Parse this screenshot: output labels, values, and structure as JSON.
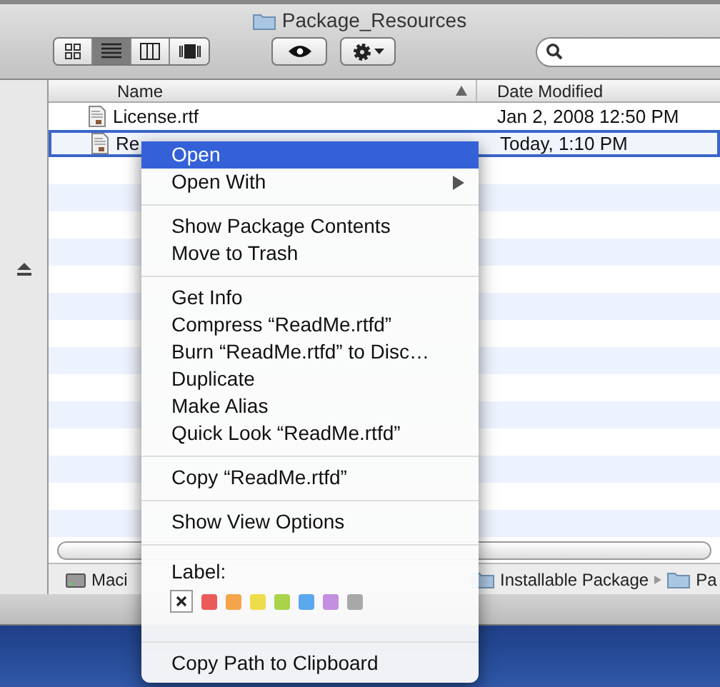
{
  "window": {
    "title": "Package_Resources"
  },
  "toolbar": {
    "view_buttons": [
      {
        "kind": "icons",
        "selected": false
      },
      {
        "kind": "list",
        "selected": true
      },
      {
        "kind": "columns",
        "selected": false
      },
      {
        "kind": "coverflow",
        "selected": false
      }
    ]
  },
  "table": {
    "columns": [
      {
        "label": "Name",
        "sorted": true
      },
      {
        "label": "Date Modified",
        "sorted": false
      }
    ],
    "rows": [
      {
        "name": "License.rtf",
        "date": "Jan 2, 2008 12:50 PM",
        "selected": false
      },
      {
        "name": "Re",
        "date": "Today, 1:10 PM",
        "selected": true
      }
    ]
  },
  "path_bar": [
    {
      "label": "Maci",
      "kind": "disk"
    },
    {
      "label": "Installable Package",
      "kind": "folder"
    },
    {
      "label": "Pa",
      "kind": "folder"
    }
  ],
  "context_menu": [
    {
      "kind": "item",
      "label": "Open",
      "selected": true,
      "submenu": false
    },
    {
      "kind": "item",
      "label": "Open With",
      "selected": false,
      "submenu": true
    },
    {
      "kind": "separator"
    },
    {
      "kind": "item",
      "label": "Show Package Contents",
      "selected": false,
      "submenu": false
    },
    {
      "kind": "item",
      "label": "Move to Trash",
      "selected": false,
      "submenu": false
    },
    {
      "kind": "separator"
    },
    {
      "kind": "item",
      "label": "Get Info",
      "selected": false,
      "submenu": false
    },
    {
      "kind": "item",
      "label": "Compress “ReadMe.rtfd”",
      "selected": false,
      "submenu": false
    },
    {
      "kind": "item",
      "label": "Burn “ReadMe.rtfd” to Disc…",
      "selected": false,
      "submenu": false
    },
    {
      "kind": "item",
      "label": "Duplicate",
      "selected": false,
      "submenu": false
    },
    {
      "kind": "item",
      "label": "Make Alias",
      "selected": false,
      "submenu": false
    },
    {
      "kind": "item",
      "label": "Quick Look “ReadMe.rtfd”",
      "selected": false,
      "submenu": false
    },
    {
      "kind": "separator"
    },
    {
      "kind": "item",
      "label": "Copy “ReadMe.rtfd”",
      "selected": false,
      "submenu": false
    },
    {
      "kind": "separator"
    },
    {
      "kind": "item",
      "label": "Show View Options",
      "selected": false,
      "submenu": false
    },
    {
      "kind": "separator"
    },
    {
      "kind": "labels",
      "label": "Label:",
      "colors": [
        {
          "color": "#eb5a5a"
        },
        {
          "color": "#f4a54a"
        },
        {
          "color": "#eedc4a"
        },
        {
          "color": "#a9d34a"
        },
        {
          "color": "#5aa8ee"
        },
        {
          "color": "#c38fe0"
        },
        {
          "color": "#a8a8a8"
        }
      ]
    },
    {
      "kind": "separator"
    },
    {
      "kind": "item",
      "label": "Copy Path to Clipboard",
      "selected": false,
      "submenu": false
    }
  ]
}
